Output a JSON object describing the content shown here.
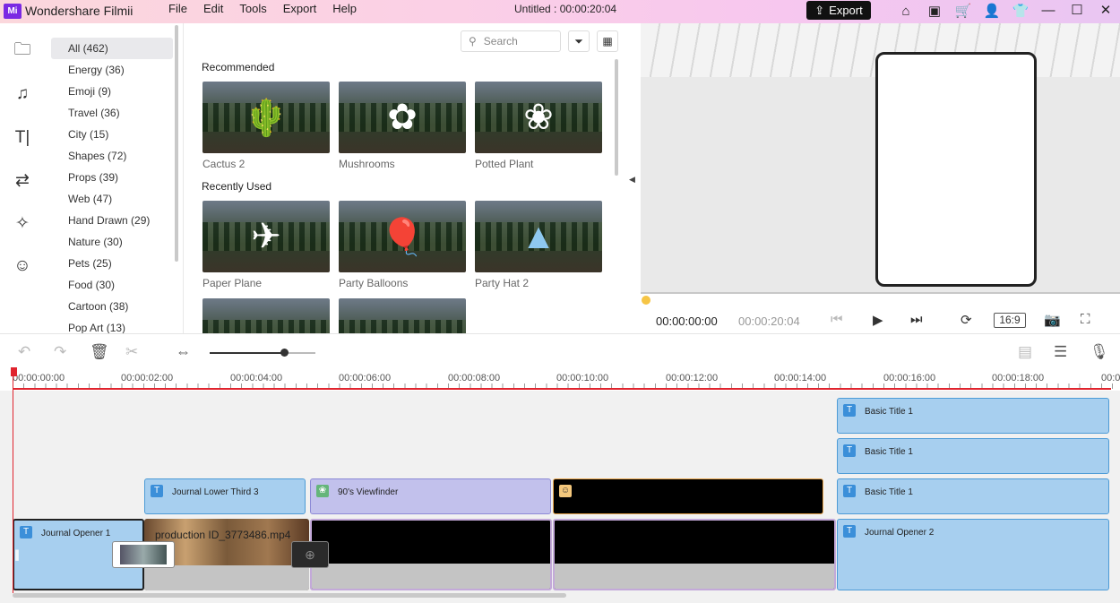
{
  "app": {
    "logo": "Mi",
    "name": "Wondershare Filmii",
    "project_title": "Untitled :  00:00:20:04"
  },
  "menu": [
    "File",
    "Edit",
    "Tools",
    "Export",
    "Help"
  ],
  "export_label": "Export",
  "top_icons": [
    "home-icon",
    "save-icon",
    "cart-icon",
    "user-icon",
    "shirt-icon"
  ],
  "sidebar_icons": [
    "folder-icon",
    "music-icon",
    "text-icon",
    "transition-icon",
    "effects-icon",
    "sticker-icon"
  ],
  "categories": [
    {
      "label": "All (462)",
      "active": true
    },
    {
      "label": "Energy (36)"
    },
    {
      "label": "Emoji (9)"
    },
    {
      "label": "Travel (36)"
    },
    {
      "label": "City (15)"
    },
    {
      "label": "Shapes (72)"
    },
    {
      "label": "Props (39)"
    },
    {
      "label": "Web (47)"
    },
    {
      "label": "Hand Drawn (29)"
    },
    {
      "label": "Nature (30)"
    },
    {
      "label": "Pets (25)"
    },
    {
      "label": "Food (30)"
    },
    {
      "label": "Cartoon (38)"
    },
    {
      "label": "Pop Art (13)"
    }
  ],
  "search": {
    "placeholder": "Search"
  },
  "sections": {
    "recommended": "Recommended",
    "recently_used": "Recently Used"
  },
  "recommended": [
    {
      "label": "Cactus 2",
      "glyph": "🌵"
    },
    {
      "label": "Mushrooms",
      "glyph": "✿"
    },
    {
      "label": "Potted Plant",
      "glyph": "❀"
    }
  ],
  "recent": [
    {
      "label": "Paper Plane",
      "glyph": "✈"
    },
    {
      "label": "Party Balloons",
      "glyph": "🎈"
    },
    {
      "label": "Party Hat 2",
      "glyph": "▲"
    }
  ],
  "player": {
    "current": "00:00:00:00",
    "total": "00:00:20:04",
    "ratio": "16:9",
    "progress": 0
  },
  "timeline": {
    "ruler": [
      "00:00:00:00",
      "00:00:02:00",
      "00:00:04:00",
      "00:00:06:00",
      "00:00:08:00",
      "00:00:10:00",
      "00:00:12:00",
      "00:00:14:00",
      "00:00:16:00",
      "00:00:18:00",
      "00:00:2"
    ],
    "zoom": 0.71,
    "clips": {
      "title1": "Basic Title 1",
      "title2": "Basic Title 1",
      "title3": "Basic Title 1",
      "lower_third": "Journal Lower Third 3",
      "viewfinder": "90's Viewfinder",
      "opener1": "Journal Opener 1",
      "video": "production ID_3773486.mp4",
      "opener2": "Journal Opener 2"
    }
  }
}
